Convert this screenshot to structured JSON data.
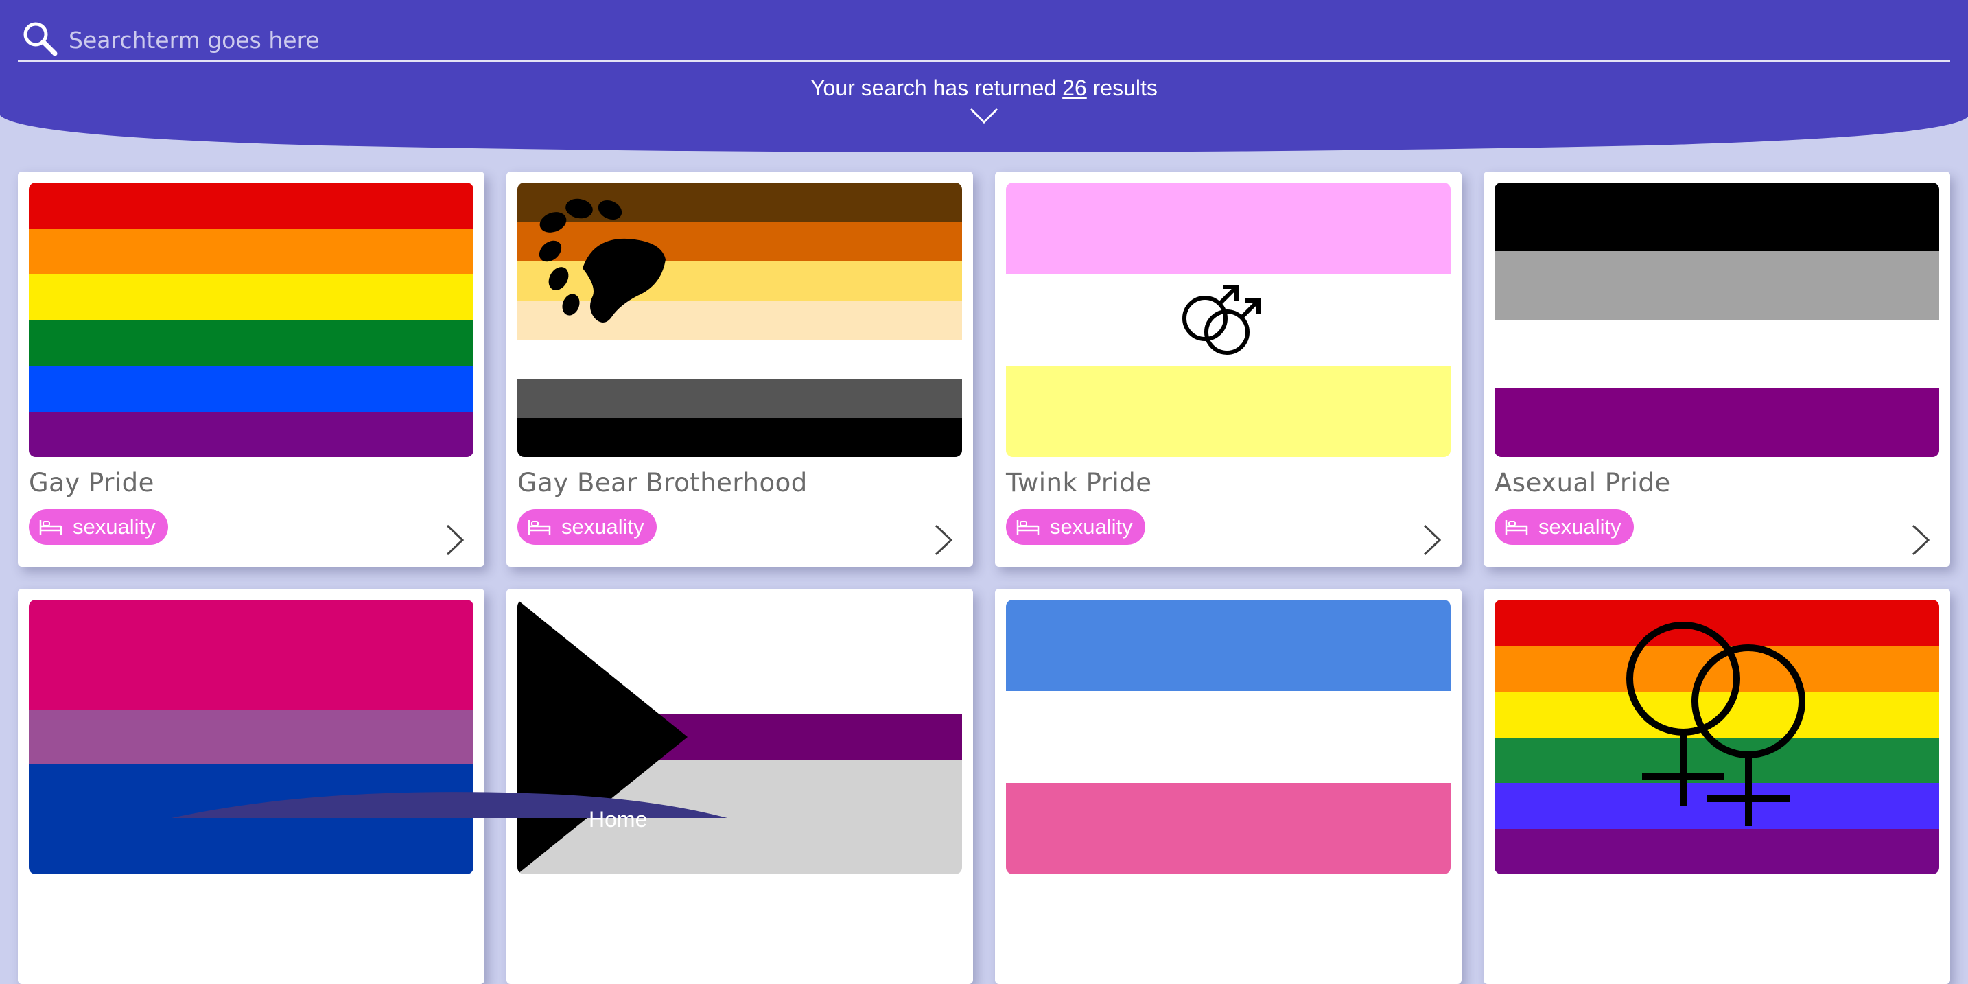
{
  "search": {
    "placeholder": "Searchterm goes here",
    "results_prefix": "Your search has returned",
    "results_count": "26",
    "results_suffix": "results"
  },
  "colors": {
    "header": "#4a42bd",
    "background": "#cbcfee",
    "tag": "#ee5fe0",
    "card": "#ffffff"
  },
  "cards": [
    {
      "title": "Gay Pride",
      "tag": "sexuality",
      "tag_icon": "bed-icon"
    },
    {
      "title": "Gay Bear Brotherhood",
      "tag": "sexuality",
      "tag_icon": "bed-icon"
    },
    {
      "title": "Twink Pride",
      "tag": "sexuality",
      "tag_icon": "bed-icon"
    },
    {
      "title": "Asexual Pride",
      "tag": "sexuality",
      "tag_icon": "bed-icon"
    },
    {
      "title": "",
      "tag": ""
    },
    {
      "title": "",
      "tag": ""
    },
    {
      "title": "",
      "tag": ""
    },
    {
      "title": "",
      "tag": ""
    }
  ],
  "bottom_menu": {
    "home_label": "Home"
  }
}
